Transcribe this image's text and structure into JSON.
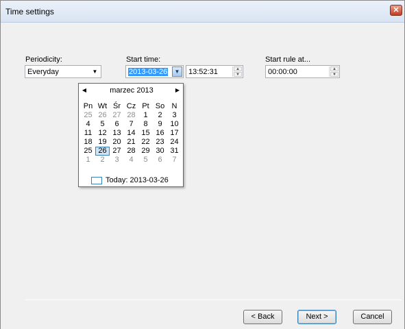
{
  "window": {
    "title": "Time settings",
    "close_glyph": "✕"
  },
  "periodicity": {
    "label": "Periodicity:",
    "value": "Everyday",
    "arrow": "▼"
  },
  "start_time": {
    "label": "Start time:",
    "date": "2013-03-26",
    "time": "13:52:31",
    "arrow": "▼"
  },
  "start_rule": {
    "label": "Start rule at...",
    "value": "00:00:00"
  },
  "spinner": {
    "up": "▲",
    "down": "▼"
  },
  "calendar": {
    "prev": "◀",
    "next": "▶",
    "month": "marzec 2013",
    "weekdays": [
      "Pn",
      "Wt",
      "Śr",
      "Cz",
      "Pt",
      "So",
      "N"
    ],
    "weeks": [
      [
        "25",
        "26",
        "27",
        "28",
        "1",
        "2",
        "3"
      ],
      [
        "4",
        "5",
        "6",
        "7",
        "8",
        "9",
        "10"
      ],
      [
        "11",
        "12",
        "13",
        "14",
        "15",
        "16",
        "17"
      ],
      [
        "18",
        "19",
        "20",
        "21",
        "22",
        "23",
        "24"
      ],
      [
        "25",
        "26",
        "27",
        "28",
        "29",
        "30",
        "31"
      ],
      [
        "1",
        "2",
        "3",
        "4",
        "5",
        "6",
        "7"
      ]
    ],
    "today_text": "Today: 2013-03-26"
  },
  "buttons": {
    "back": "< Back",
    "next": "Next >",
    "cancel": "Cancel"
  },
  "colors": {
    "selection": "#3399ff",
    "today_border": "#3c7fb1",
    "other_month": "#8d8d8d"
  }
}
